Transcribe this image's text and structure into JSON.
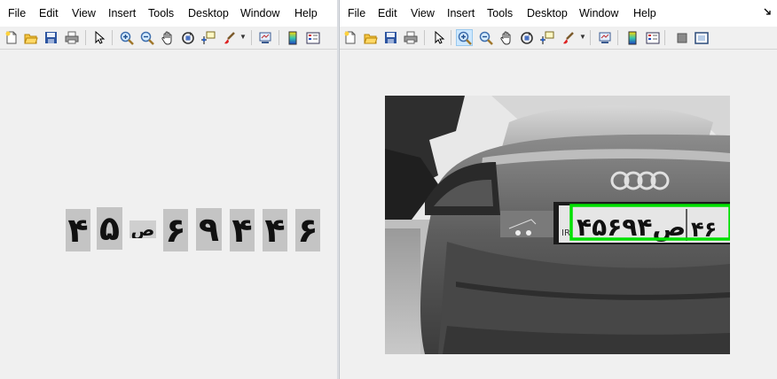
{
  "left_window": {
    "menu": [
      "File",
      "Edit",
      "View",
      "Insert",
      "Tools",
      "Desktop",
      "Window",
      "Help"
    ],
    "toolbar_icons": [
      "new-figure-icon",
      "open-file-icon",
      "save-icon",
      "print-icon",
      "pointer-icon",
      "zoom-in-icon",
      "zoom-out-icon",
      "pan-icon",
      "rotate-3d-icon",
      "data-cursor-icon",
      "brush-icon",
      "link-plot-icon",
      "colorbar-icon",
      "legend-icon"
    ],
    "plate_characters": [
      "۴",
      "۵",
      "ص",
      "۶",
      "۹",
      "۴",
      "۴",
      "۶"
    ]
  },
  "right_window": {
    "menu": [
      "File",
      "Edit",
      "View",
      "Insert",
      "Tools",
      "Desktop",
      "Window",
      "Help"
    ],
    "toolbar_icons": [
      "new-figure-icon",
      "open-file-icon",
      "save-icon",
      "print-icon",
      "pointer-icon",
      "zoom-in-icon",
      "zoom-out-icon",
      "pan-icon",
      "rotate-3d-icon",
      "data-cursor-icon",
      "brush-icon",
      "link-plot-icon",
      "colorbar-icon",
      "legend-icon",
      "hide-tools-icon",
      "show-tools-icon"
    ],
    "active_tool": "zoom-in-icon",
    "plate_text": "۴۵ص۶۹۴",
    "plate_region": "۴۶",
    "detection_box_color": "#00e000"
  }
}
